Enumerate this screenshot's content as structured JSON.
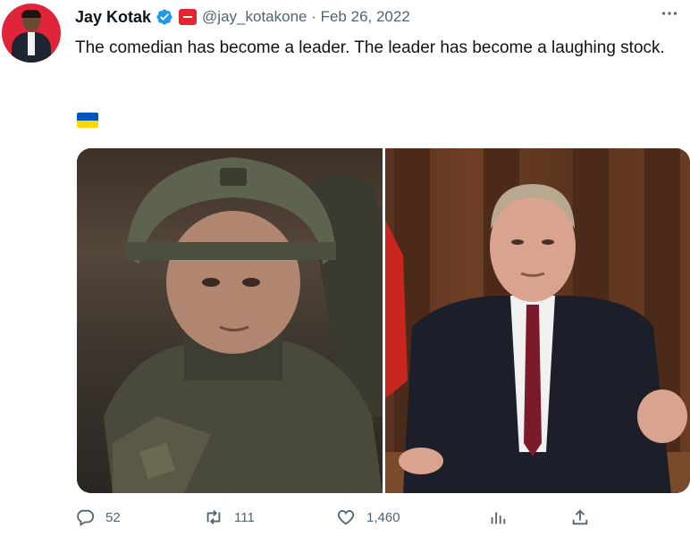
{
  "author": {
    "name": "Jay Kotak",
    "handle_line": "@jay_kotakone · Feb 26, 2022",
    "verified_icon": "verified-badge-icon",
    "affiliate_color": "#e3262f"
  },
  "tweet": {
    "text": "The comedian has become a leader. The leader has become a laughing stock.",
    "flag": "ukraine-flag-emoji"
  },
  "colors": {
    "accent": "#1d9bf0",
    "secondary_text": "#536471"
  },
  "actions": {
    "replies": "52",
    "retweets": "111",
    "likes": "1,460"
  },
  "icons": [
    "more-icon",
    "reply-icon",
    "retweet-icon",
    "like-icon",
    "views-icon",
    "share-icon"
  ]
}
